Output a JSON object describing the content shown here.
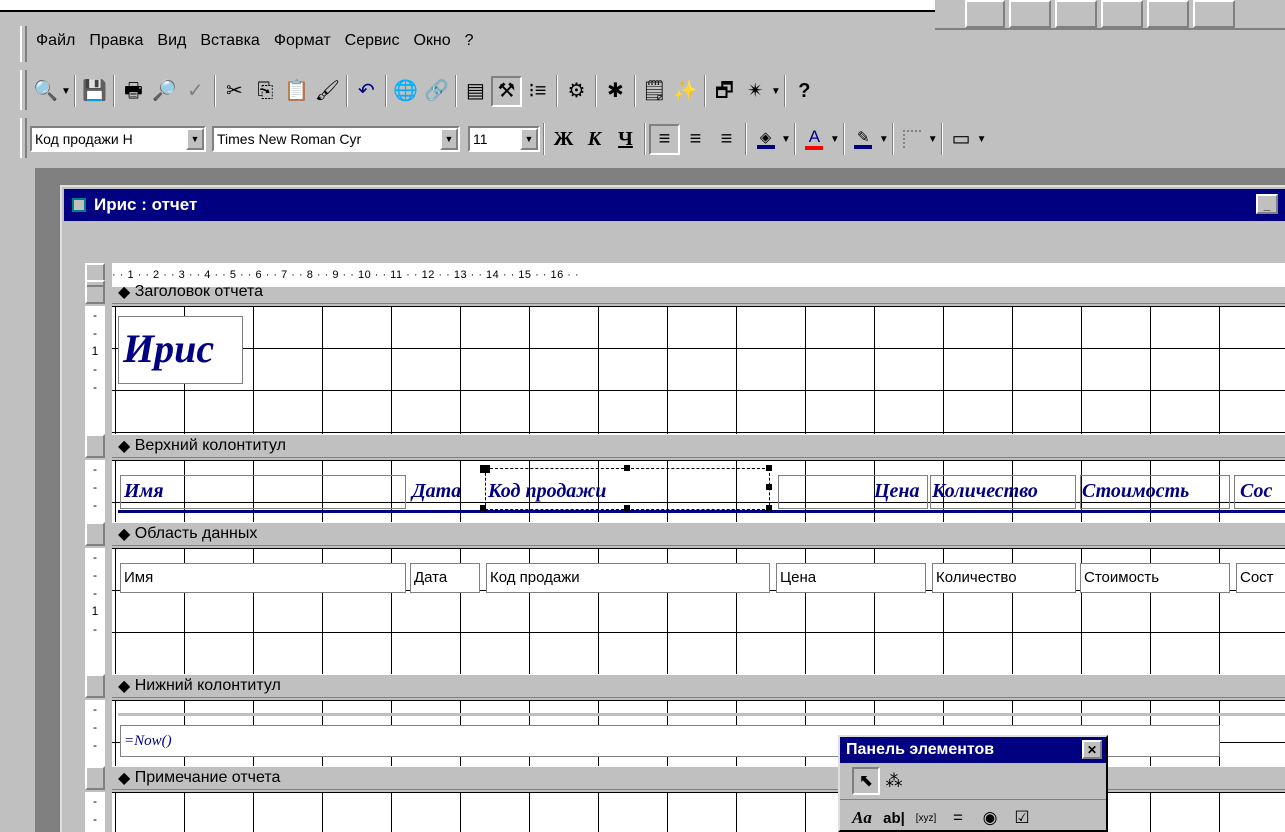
{
  "menu": [
    "Файл",
    "Правка",
    "Вид",
    "Вставка",
    "Формат",
    "Сервис",
    "Окно",
    "?"
  ],
  "toolbar1_icons": [
    "view-icon",
    "save-icon",
    "print-icon",
    "preview-icon",
    "spell-icon",
    "cut-icon",
    "copy-icon",
    "paste-icon",
    "format-painter-icon",
    "undo-icon",
    "web-icon",
    "hyperlink-icon",
    "field-list-icon",
    "toolbox-icon",
    "sorting-icon",
    "properties-icon",
    "builder-icon",
    "database-window-icon",
    "new-object-icon",
    "help-icon"
  ],
  "format": {
    "object": "Код продажи Н",
    "font": "Times New Roman Cyr",
    "size": "11",
    "bold": "Ж",
    "italic": "К",
    "underline": "Ч",
    "align_left": "≡",
    "align_center": "≡",
    "align_right": "≡",
    "fill_glyph": "◈",
    "font_color_glyph": "A",
    "line_color_glyph": "✎",
    "fill_color": "#000080",
    "text_color": "#ff0000"
  },
  "window": {
    "title": "Ирис : отчет"
  },
  "ruler": "· · 1 · · 2 · · 3 · · 4 · · 5 · · 6 · · 7 · · 8 · · 9 · · 10 · · 11 · · 12 · · 13 · · 14 · · 15 · · 16 · ·",
  "vruler_mark": "1",
  "sections": {
    "report_header": "Заголовок отчета",
    "page_header": "Верхний колонтитул",
    "detail": "Область данных",
    "page_footer": "Нижний колонтитул",
    "report_footer": "Примечание отчета"
  },
  "report_title": "Ирис",
  "header_labels": [
    "Имя",
    "Дата",
    "Код продажи",
    "Цена",
    "Количество",
    "Стоимость",
    "Сос"
  ],
  "detail_fields": [
    "Имя",
    "Дата",
    "Код продажи",
    "Цена",
    "Количество",
    "Стоимость",
    "Сост"
  ],
  "footer_expr": "=Now()",
  "toolbox": {
    "title": "Панель элементов",
    "close": "✕",
    "row2": [
      "Aa",
      "ab|",
      "[xyz]",
      "=",
      "◉",
      "☑"
    ]
  }
}
